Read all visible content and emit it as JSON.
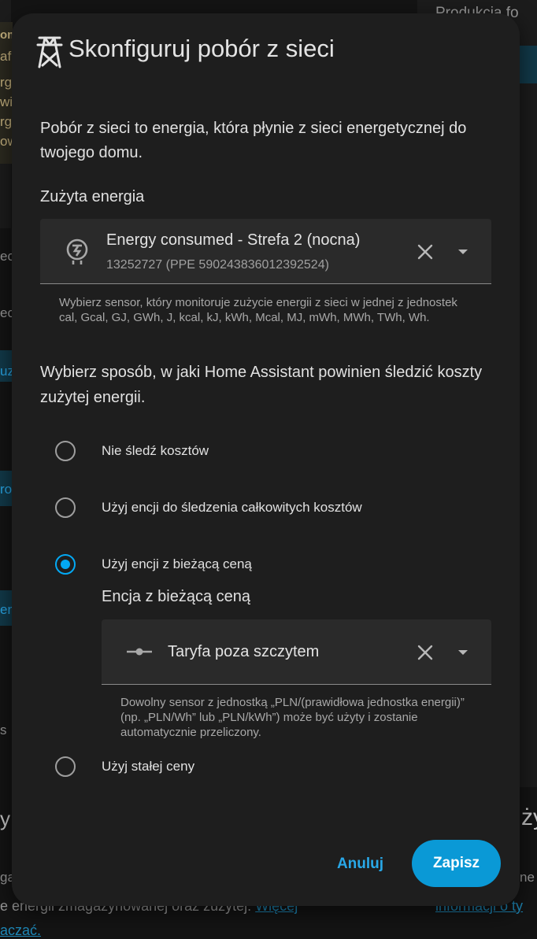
{
  "background": {
    "top_right_title": "Produkcja fo",
    "left_fragments": [
      "om",
      "afi",
      "rga",
      "wi",
      "rga",
      "ow",
      "ec",
      "ec",
      "uz",
      "ro",
      "en",
      "s",
      "y",
      "ga"
    ],
    "right_fragments": [
      "ży",
      "ne"
    ],
    "bottom_text": "e energii zmagazynowanej oraz zużytej.",
    "bottom_link_1": "Więcej",
    "bottom_link_2": "aczać.",
    "bottom_right_link": "informacji o ty"
  },
  "dialog": {
    "icon": "transmission-tower-icon",
    "title": "Skonfiguruj pobór z sieci",
    "intro": "Pobór z sieci to energia, która płynie z sieci energetycznej do twojego domu.",
    "energy_section_label": "Zużyta energia",
    "energy_picker": {
      "icon": "meter-electric-icon",
      "primary": "Energy consumed - Strefa 2 (nocna)",
      "secondary": "13252727 (PPE 590243836012392524)"
    },
    "energy_helper": "Wybierz sensor, który monitoruje zużycie energii z sieci w jednej z jednostek cal, Gcal, GJ, GWh, J, kcal, kJ, kWh, Mcal, MJ, mWh, MWh, TWh, Wh.",
    "cost_question": "Wybierz sposób, w jaki Home Assistant powinien śledzić koszty zużytej energii.",
    "options": [
      {
        "label": "Nie śledź kosztów",
        "checked": false
      },
      {
        "label": "Użyj encji do śledzenia całkowitych kosztów",
        "checked": false
      },
      {
        "label": "Użyj encji z bieżącą ceną",
        "checked": true
      },
      {
        "label": "Użyj stałej ceny",
        "checked": false
      }
    ],
    "price_entity_label": "Encja z bieżącą ceną",
    "price_picker": {
      "icon": "slider-input-icon",
      "value": "Taryfa poza szczytem"
    },
    "price_helper": "Dowolny sensor z jednostką „PLN/(prawidłowa jednostka energii)” (np. „PLN/Wh” lub „PLN/kWh”) może być użyty i zostanie automatycznie przeliczony.",
    "cancel_label": "Anuluj",
    "save_label": "Zapisz"
  },
  "colors": {
    "accent": "#03a9f4",
    "save_button": "#0a99d6",
    "dialog_bg": "#1e1e1e"
  }
}
